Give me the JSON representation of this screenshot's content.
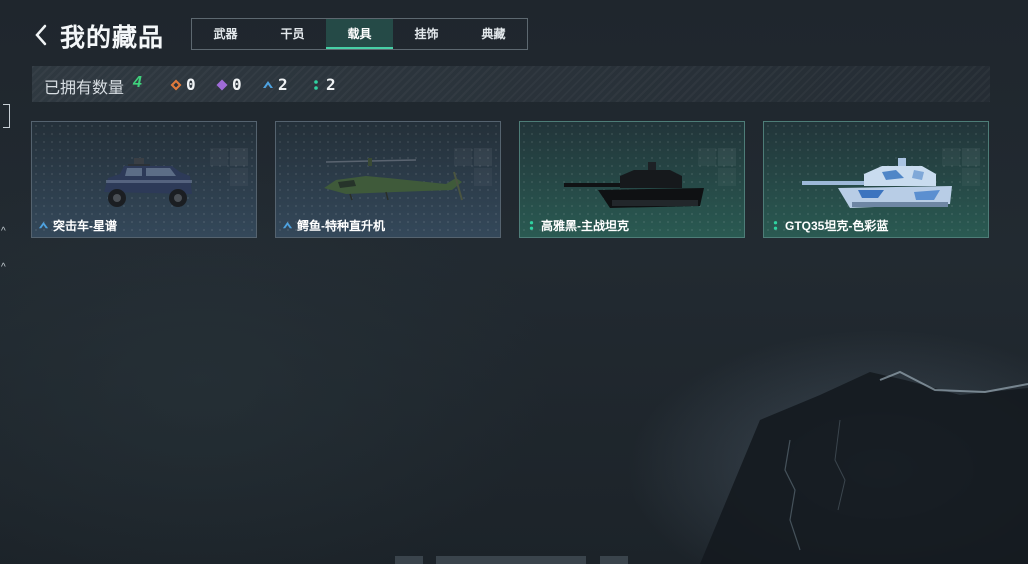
{
  "header": {
    "title": "我的藏品",
    "tabs": [
      {
        "label": "武器",
        "active": false
      },
      {
        "label": "干员",
        "active": false
      },
      {
        "label": "载具",
        "active": true
      },
      {
        "label": "挂饰",
        "active": false
      },
      {
        "label": "典藏",
        "active": false
      }
    ]
  },
  "stats": {
    "owned_label": "已拥有数量",
    "owned_count": "4",
    "rarities": [
      {
        "icon": "orange-diamond-icon",
        "color": "#e07a3c",
        "value": "0"
      },
      {
        "icon": "purple-diamond-icon",
        "color": "#9f6bd8",
        "value": "0"
      },
      {
        "icon": "blue-chevron-icon",
        "color": "#4ea2e0",
        "value": "2"
      },
      {
        "icon": "green-dots-icon",
        "color": "#2fd2a0",
        "value": "2"
      }
    ]
  },
  "items": [
    {
      "name": "突击车-星谱",
      "rarity_icon": "blue-chevron-icon",
      "rarity_color": "#4ea2e0",
      "vehicle_icon": "assault-vehicle-icon"
    },
    {
      "name": "鳄鱼-特种直升机",
      "rarity_icon": "blue-chevron-icon",
      "rarity_color": "#4ea2e0",
      "vehicle_icon": "helicopter-icon"
    },
    {
      "name": "高雅黑-主战坦克",
      "rarity_icon": "green-dots-icon",
      "rarity_color": "#2fd2a0",
      "vehicle_icon": "tank-icon"
    },
    {
      "name": "GTQ35坦克-色彩蓝",
      "rarity_icon": "green-dots-icon",
      "rarity_color": "#2fd2a0",
      "vehicle_icon": "camo-tank-icon"
    }
  ],
  "colors": {
    "accent_green": "#3fd27c",
    "tab_active_bg": "#254a47",
    "background": "#1f262d"
  }
}
